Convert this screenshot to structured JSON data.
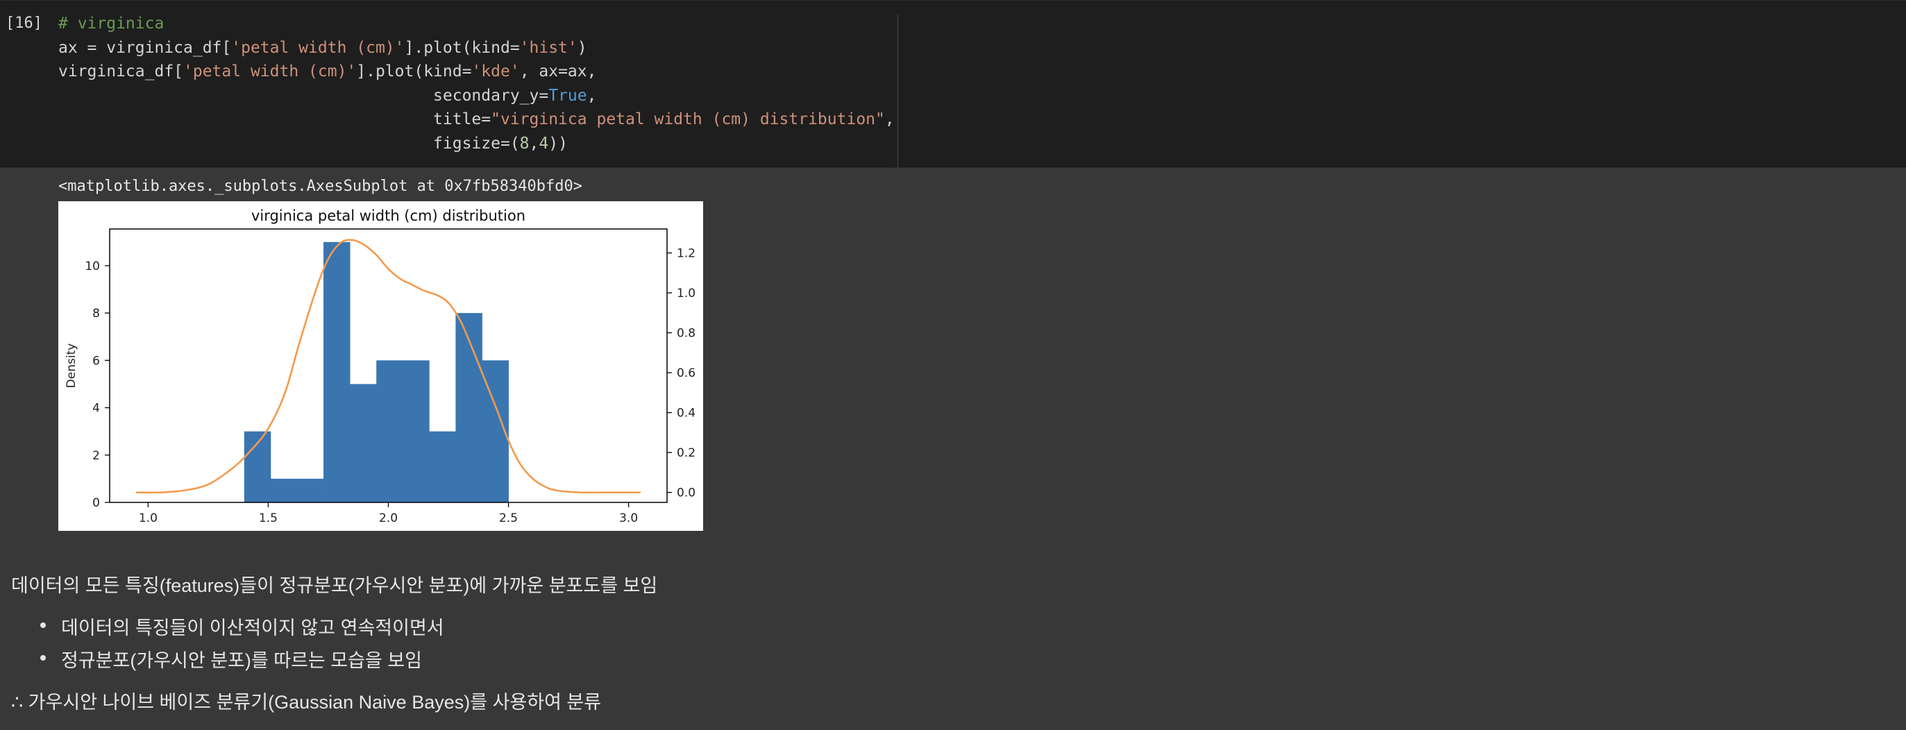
{
  "cell": {
    "execution_count": "[16]",
    "code_lines": [
      [
        {
          "t": "# virginica",
          "c": "cmt"
        }
      ],
      [
        {
          "t": "ax = virginica_df[",
          "c": ""
        },
        {
          "t": "'petal width (cm)'",
          "c": "str"
        },
        {
          "t": "].plot(kind=",
          "c": ""
        },
        {
          "t": "'hist'",
          "c": "str"
        },
        {
          "t": ")",
          "c": ""
        }
      ],
      [
        {
          "t": "virginica_df[",
          "c": ""
        },
        {
          "t": "'petal width (cm)'",
          "c": "str"
        },
        {
          "t": "].plot(kind=",
          "c": ""
        },
        {
          "t": "'kde'",
          "c": "str"
        },
        {
          "t": ", ax=ax,",
          "c": ""
        }
      ],
      [
        {
          "t": "                                       secondary_y=",
          "c": ""
        },
        {
          "t": "True",
          "c": "kw"
        },
        {
          "t": ",",
          "c": ""
        }
      ],
      [
        {
          "t": "                                       title=",
          "c": ""
        },
        {
          "t": "\"virginica petal width (cm) distribution\"",
          "c": "str"
        },
        {
          "t": ",",
          "c": ""
        }
      ],
      [
        {
          "t": "                                       figsize=(",
          "c": ""
        },
        {
          "t": "8",
          "c": "num"
        },
        {
          "t": ",",
          "c": ""
        },
        {
          "t": "4",
          "c": "num"
        },
        {
          "t": "))",
          "c": ""
        }
      ]
    ]
  },
  "output": {
    "repr": "<matplotlib.axes._subplots.AxesSubplot at 0x7fb58340bfd0>"
  },
  "chart_data": {
    "type": "bar",
    "title": "virginica petal width (cm) distribution",
    "ylabel": "Density",
    "xlabel": "",
    "x_ticks": [
      "1.0",
      "1.5",
      "2.0",
      "2.5",
      "3.0"
    ],
    "y_ticks_left": [
      "0",
      "2",
      "4",
      "6",
      "8",
      "10"
    ],
    "y_ticks_right": [
      "0.0",
      "0.2",
      "0.4",
      "0.6",
      "0.8",
      "1.0",
      "1.2"
    ],
    "xlim": [
      0.84,
      3.16
    ],
    "ylim_left": [
      0,
      11.55
    ],
    "ylim_right": [
      -0.05,
      1.32
    ],
    "hist_color": "#3a75b0",
    "kde_color": "#f39a4d",
    "histogram": {
      "bin_edges": [
        1.4,
        1.51,
        1.62,
        1.73,
        1.84,
        1.95,
        2.06,
        2.17,
        2.28,
        2.39,
        2.5
      ],
      "counts": [
        3,
        1,
        1,
        11,
        5,
        6,
        6,
        3,
        8,
        6
      ]
    },
    "kde": {
      "x": [
        0.95,
        1.05,
        1.15,
        1.25,
        1.35,
        1.42,
        1.5,
        1.57,
        1.63,
        1.7,
        1.75,
        1.8,
        1.85,
        1.9,
        1.95,
        2.0,
        2.05,
        2.1,
        2.15,
        2.2,
        2.25,
        2.3,
        2.35,
        2.4,
        2.45,
        2.5,
        2.55,
        2.6,
        2.65,
        2.7,
        2.8,
        2.9,
        3.05
      ],
      "y": [
        0.0,
        0.0,
        0.01,
        0.04,
        0.12,
        0.2,
        0.32,
        0.5,
        0.75,
        1.02,
        1.17,
        1.25,
        1.265,
        1.24,
        1.19,
        1.12,
        1.07,
        1.04,
        1.01,
        0.99,
        0.95,
        0.86,
        0.72,
        0.57,
        0.42,
        0.26,
        0.14,
        0.07,
        0.03,
        0.01,
        0.0,
        0.0,
        0.0
      ]
    }
  },
  "markdown": {
    "line1": "데이터의 모든 특징(features)들이 정규분포(가우시안 분포)에 가까운 분포도를 보임",
    "bullets": [
      "데이터의 특징들이 이산적이지 않고 연속적이면서",
      "정규분포(가우시안 분포)를 따르는 모습을 보임"
    ],
    "conclusion": "∴ 가우시안 나이브 베이즈 분류기(Gaussian Naive Bayes)를 사용하여 분류"
  }
}
